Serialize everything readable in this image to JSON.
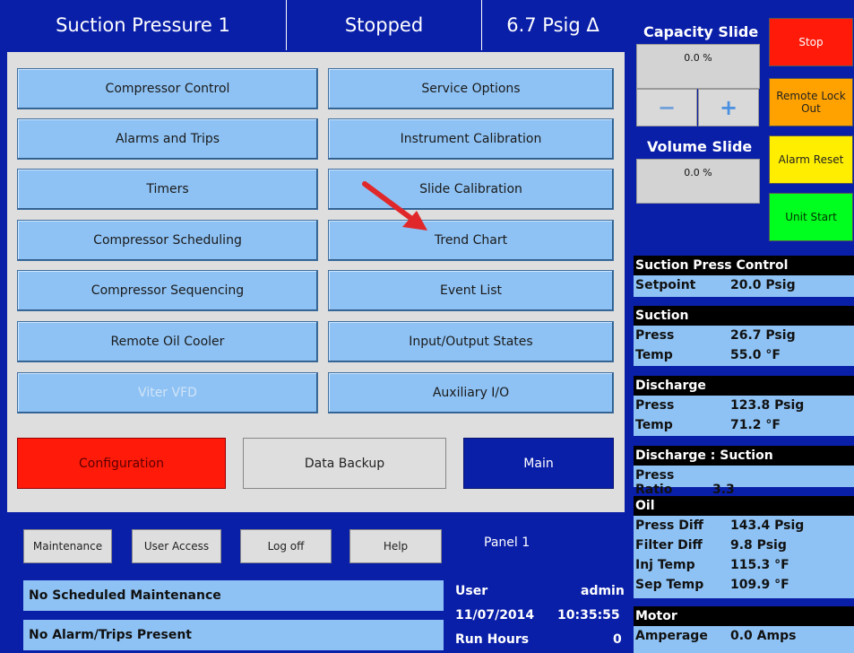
{
  "header": {
    "title": "Suction Pressure 1",
    "status": "Stopped",
    "pressure_diff": "6.7 Psig Δ"
  },
  "menu": {
    "left": [
      "Compressor Control",
      "Alarms and Trips",
      "Timers",
      "Compressor Scheduling",
      "Compressor Sequencing",
      "Remote Oil Cooler",
      "Viter VFD"
    ],
    "right": [
      "Service Options",
      "Instrument Calibration",
      "Slide Calibration",
      "Trend Chart",
      "Event List",
      "Input/Output States",
      "Auxiliary I/O"
    ],
    "configuration": "Configuration",
    "data_backup": "Data Backup",
    "main": "Main"
  },
  "bottom": {
    "maintenance": "Maintenance",
    "user_access": "User Access",
    "log_off": "Log off",
    "help": "Help",
    "panel": "Panel 1",
    "maintenance_status": "No Scheduled Maintenance",
    "alarm_status": "No Alarm/Trips Present",
    "user_label": "User",
    "user_value": "admin",
    "date": "11/07/2014",
    "time": "10:35:55",
    "run_hours_label": "Run Hours",
    "run_hours_value": "0"
  },
  "slides": {
    "capacity_title": "Capacity Slide",
    "capacity_value": "0.0 %",
    "minus": "−",
    "plus": "+",
    "volume_title": "Volume Slide",
    "volume_value": "0.0 %"
  },
  "side_buttons": {
    "stop": "Stop",
    "remote_lock": "Remote Lock Out",
    "alarm_reset": "Alarm Reset",
    "unit_start": "Unit Start"
  },
  "readings": {
    "suction_press_control": {
      "title": "Suction Press Control",
      "setpoint_label": "Setpoint",
      "setpoint": "20.0 Psig"
    },
    "suction": {
      "title": "Suction",
      "press_label": "Press",
      "press": "26.7 Psig",
      "temp_label": "Temp",
      "temp": "55.0 °F"
    },
    "discharge": {
      "title": "Discharge",
      "press_label": "Press",
      "press": "123.8 Psig",
      "temp_label": "Temp",
      "temp": "71.2 °F"
    },
    "ratio": {
      "title": "Discharge : Suction",
      "label": "Press Ratio",
      "value": "3.3"
    },
    "oil": {
      "title": "Oil",
      "press_diff_label": "Press Diff",
      "press_diff": "143.4 Psig",
      "filter_diff_label": "Filter Diff",
      "filter_diff": "9.8 Psig",
      "inj_temp_label": "Inj Temp",
      "inj_temp": "115.3 °F",
      "sep_temp_label": "Sep Temp",
      "sep_temp": "109.9 °F"
    },
    "motor": {
      "title": "Motor",
      "amperage_label": "Amperage",
      "amperage": "0.0 Amps"
    }
  },
  "colors": {
    "background": "#0a1fa8",
    "button_blue": "#8ec2f4",
    "stop_red": "#ff1a0a",
    "lock_orange": "#ffa200",
    "reset_yellow": "#ffee00",
    "start_green": "#00ff1e",
    "arrow": "#e0282a"
  }
}
